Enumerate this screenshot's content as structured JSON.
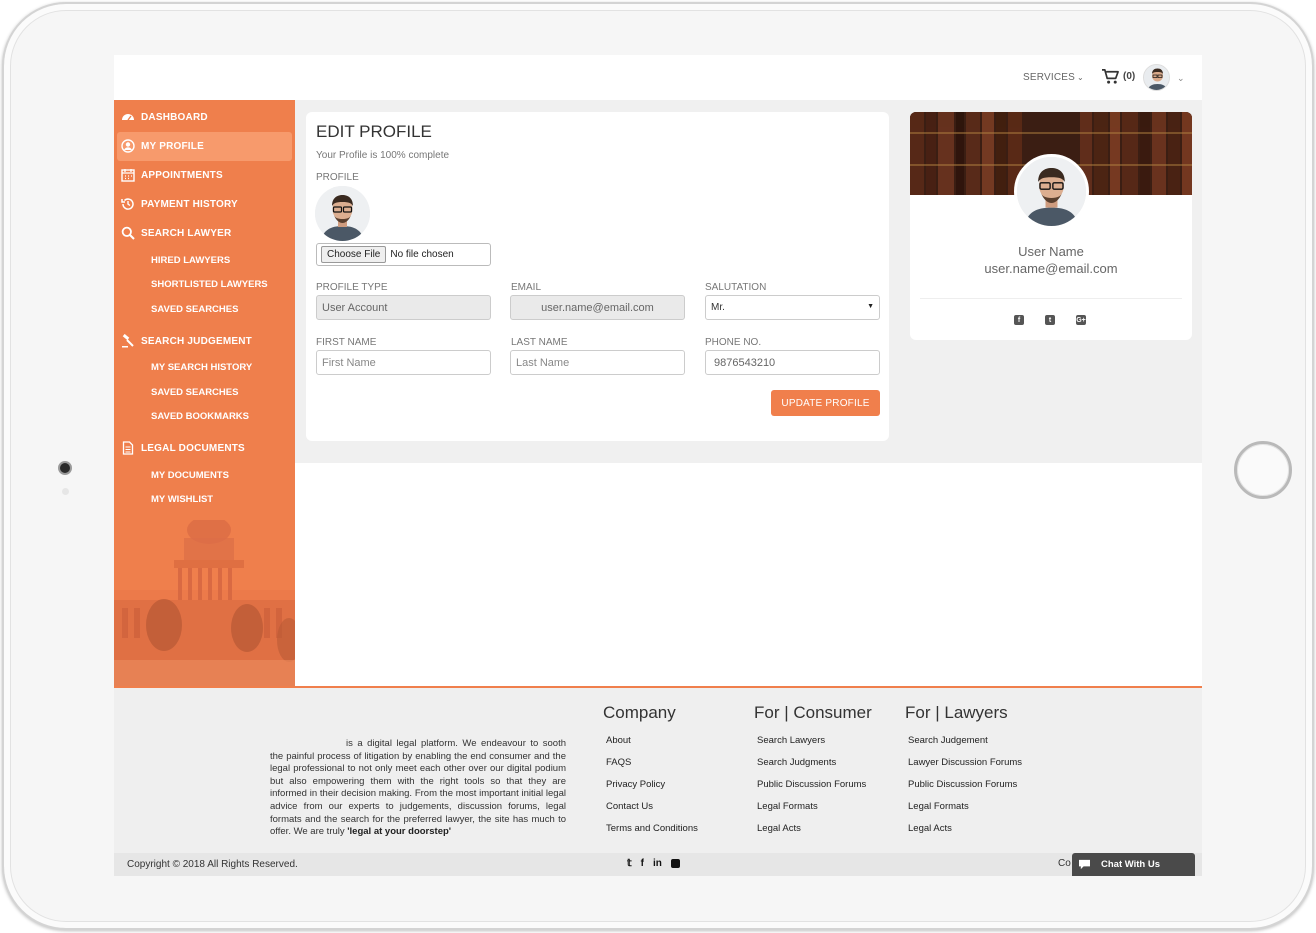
{
  "topnav": {
    "services_label": "SERVICES",
    "cart_count": "(0)"
  },
  "sidebar": {
    "items": [
      {
        "type": "main",
        "label": "DASHBOARD",
        "icon": "dashboard-icon"
      },
      {
        "type": "main",
        "label": "MY PROFILE",
        "icon": "user-circle-icon",
        "active": true
      },
      {
        "type": "main",
        "label": "APPOINTMENTS",
        "icon": "calendar-icon"
      },
      {
        "type": "main",
        "label": "PAYMENT HISTORY",
        "icon": "history-icon"
      },
      {
        "type": "main",
        "label": "SEARCH LAWYER",
        "icon": "search-icon"
      },
      {
        "type": "sub",
        "label": "HIRED LAWYERS"
      },
      {
        "type": "sub",
        "label": "SHORTLISTED LAWYERS"
      },
      {
        "type": "sub",
        "label": "SAVED SEARCHES"
      },
      {
        "type": "main",
        "label": "SEARCH JUDGEMENT",
        "icon": "gavel-icon"
      },
      {
        "type": "sub",
        "label": "MY SEARCH HISTORY"
      },
      {
        "type": "sub",
        "label": "SAVED SEARCHES"
      },
      {
        "type": "sub",
        "label": "SAVED BOOKMARKS"
      },
      {
        "type": "main",
        "label": "LEGAL DOCUMENTS",
        "icon": "document-icon"
      },
      {
        "type": "sub",
        "label": "MY DOCUMENTS"
      },
      {
        "type": "sub",
        "label": "MY WISHLIST"
      }
    ]
  },
  "edit_profile": {
    "title": "EDIT PROFILE",
    "completion": "Your Profile is 100% complete",
    "profile_label": "PROFILE",
    "file_button": "Choose File",
    "file_status": "No file chosen",
    "fields": {
      "profile_type": {
        "label": "PROFILE TYPE",
        "value": "User Account"
      },
      "email": {
        "label": "EMAIL",
        "value": "user.name@email.com"
      },
      "salutation": {
        "label": "SALUTATION",
        "value": "Mr."
      },
      "first_name": {
        "label": "FIRST NAME",
        "placeholder": "First Name"
      },
      "last_name": {
        "label": "LAST NAME",
        "placeholder": "Last Name"
      },
      "phone": {
        "label": "PHONE NO.",
        "value": "9876543210"
      }
    },
    "update_button": "UPDATE PROFILE"
  },
  "summary": {
    "name": "User Name",
    "email": "user.name@email.com",
    "social": [
      "f",
      "t",
      "G+"
    ]
  },
  "footer": {
    "about_text": "is a digital legal platform. We endeavour to sooth the painful process of litigation by enabling the end consumer and the legal professional to not only meet each other over our digital podium but also empowering them with the right tools so that they are informed in their decision making. From the most important initial legal advice from our experts to judgements, discussion forums, legal formats and the search for the preferred lawyer, the site has much to offer. We are truly",
    "about_bold": "'legal at your doorstep'",
    "columns": [
      {
        "heading": "Company",
        "items": [
          "About",
          "FAQS",
          "Privacy Policy",
          "Contact Us",
          "Terms and Conditions"
        ]
      },
      {
        "heading": "For | Consumer",
        "items": [
          "Search Lawyers",
          "Search Judgments",
          "Public Discussion Forums",
          "Legal Formats",
          "Legal Acts"
        ]
      },
      {
        "heading": "For | Lawyers",
        "items": [
          "Search Judgement",
          "Lawyer Discussion Forums",
          "Public Discussion Forums",
          "Legal Formats",
          "Legal Acts"
        ]
      }
    ],
    "copyright": "Copyright © 2018   All Rights Reserved.",
    "social": [
      "t",
      "f",
      "in",
      "fl"
    ],
    "cookie_partial": "Co",
    "chat_label": "Chat With Us"
  },
  "colors": {
    "accent": "#f07f4c",
    "sidebar": "#ef7f4c",
    "sidebar_active": "#f79a6c"
  }
}
